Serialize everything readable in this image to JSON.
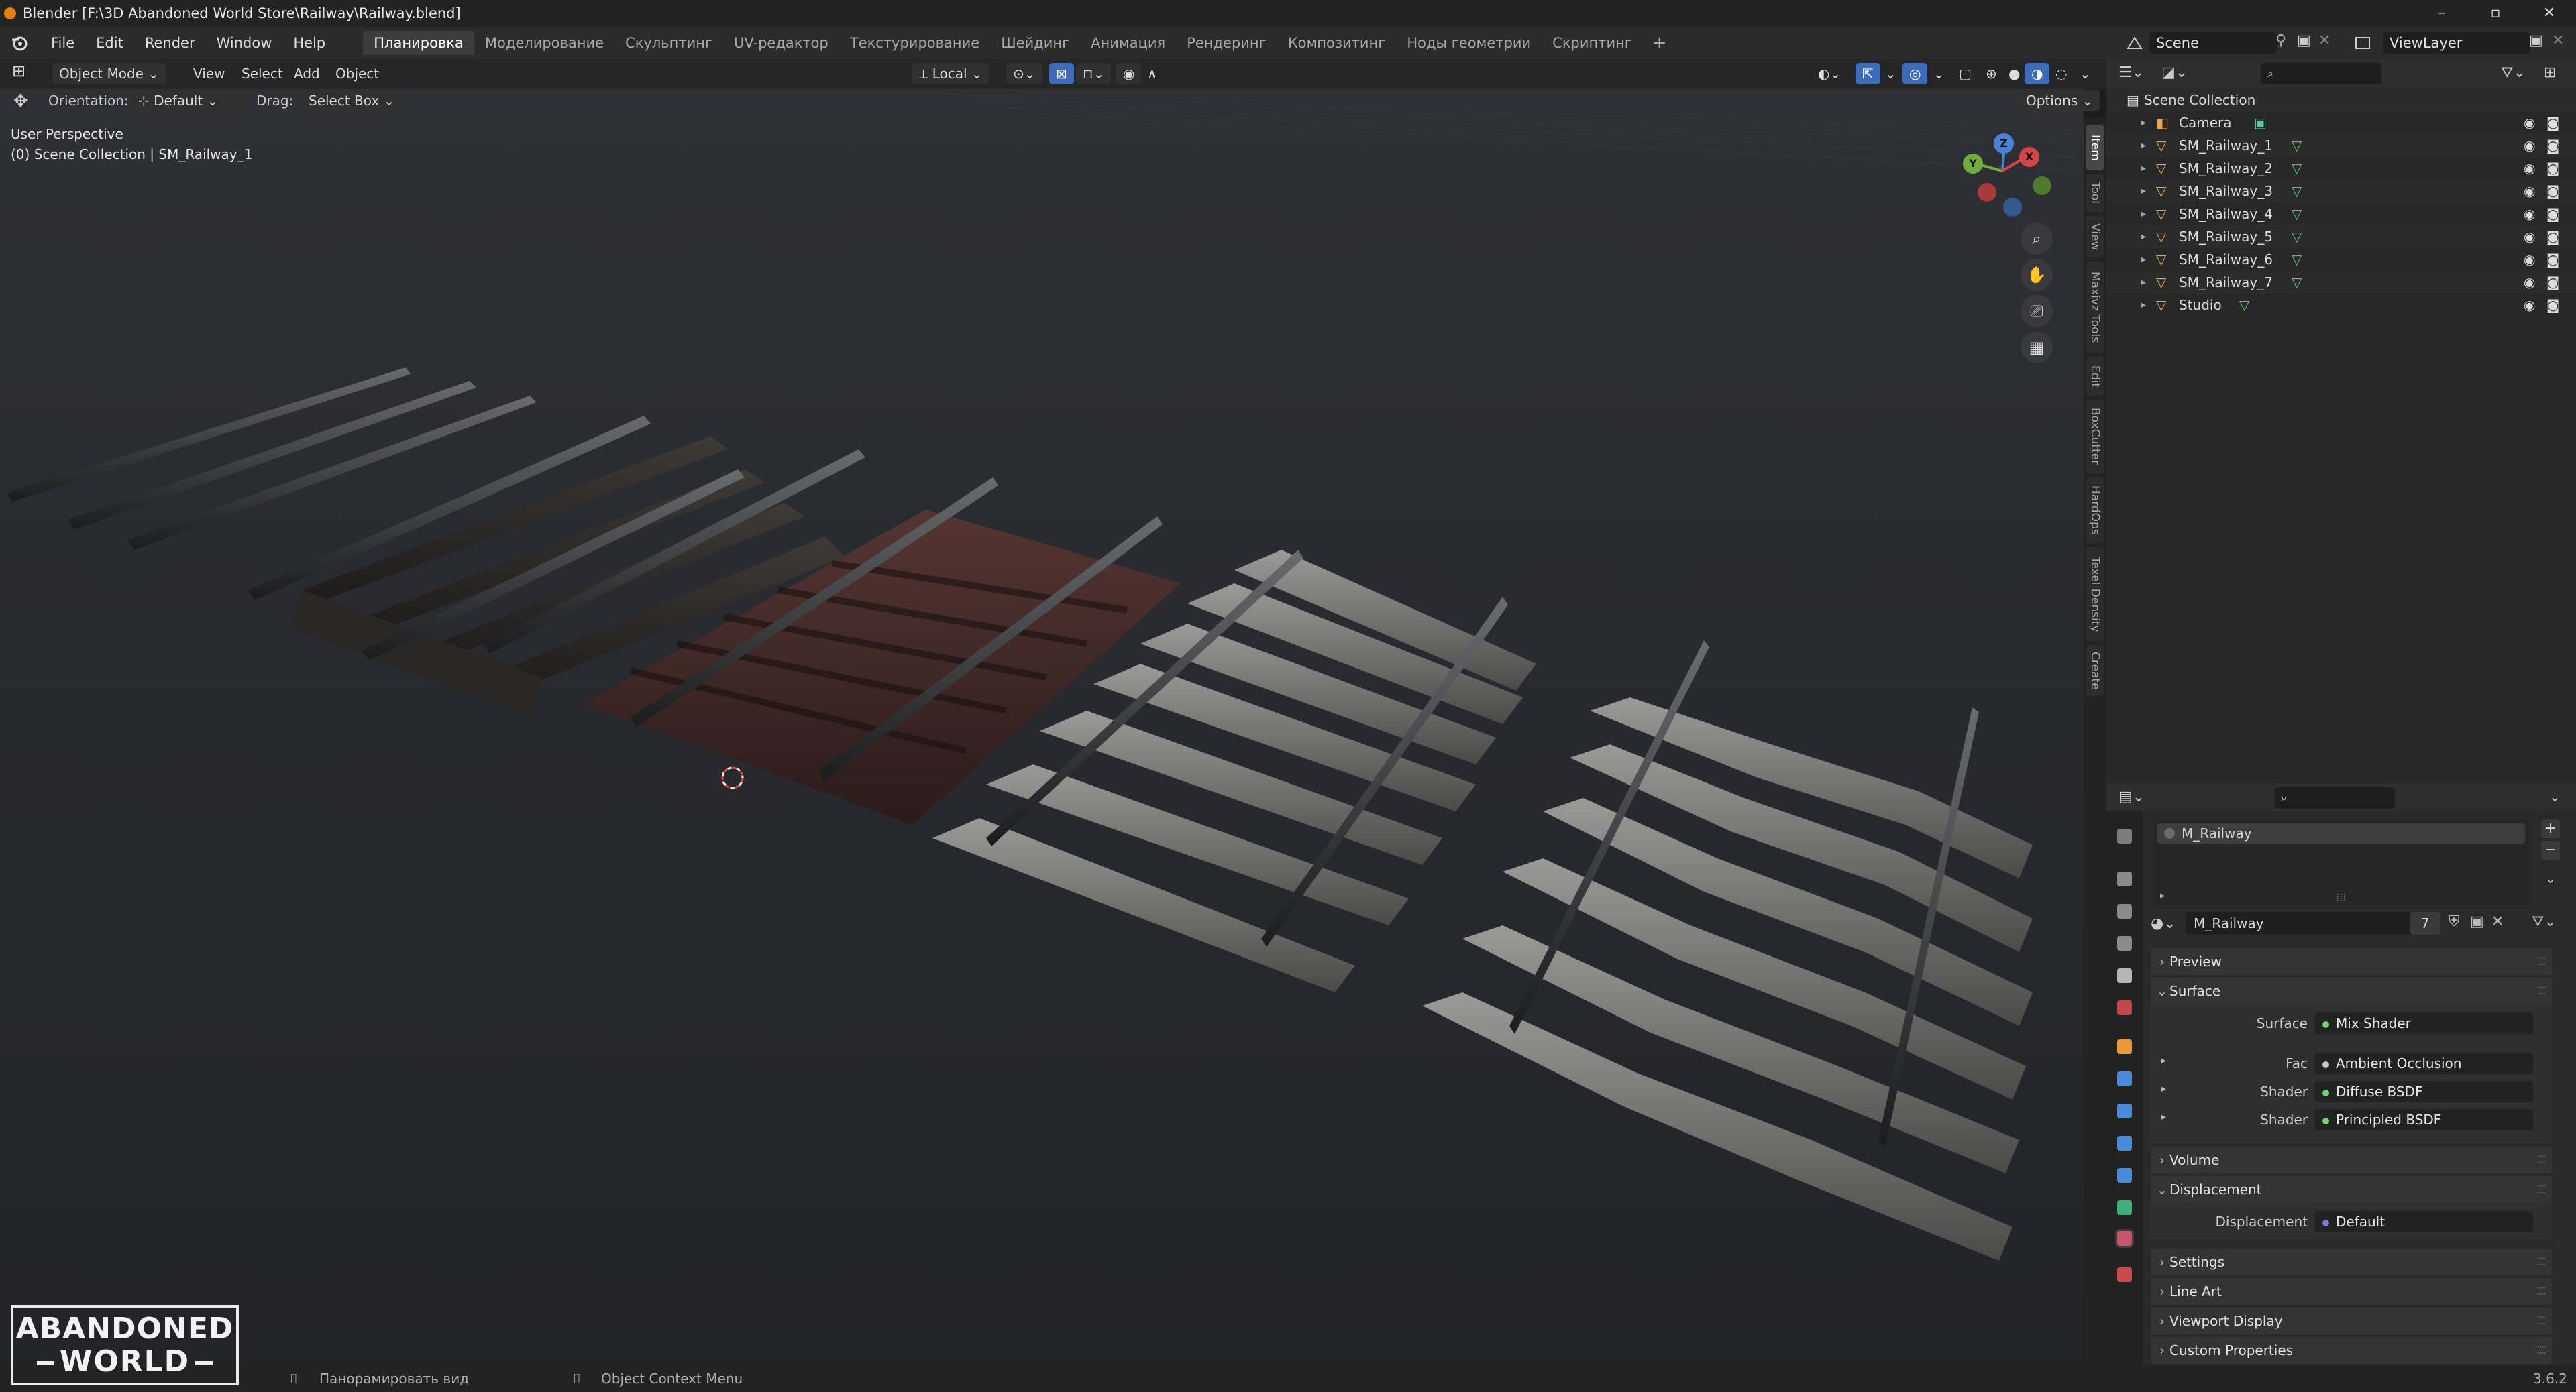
{
  "window": {
    "title": "Blender [F:\\3D Abandoned World Store\\Railway\\Railway.blend]",
    "controls": [
      "–",
      "▫",
      "✕"
    ]
  },
  "menu": {
    "items": [
      "File",
      "Edit",
      "Render",
      "Window",
      "Help"
    ],
    "workspaces": [
      "Планировка",
      "Моделирование",
      "Скульптинг",
      "UV-редактор",
      "Текстурирование",
      "Шейдинг",
      "Анимация",
      "Рендеринг",
      "Композитинг",
      "Ноды геометрии",
      "Скриптинг"
    ],
    "active_workspace": "Планировка",
    "add_workspace": "+"
  },
  "scene": {
    "name": "Scene",
    "view_layer": "ViewLayer"
  },
  "viewport_header": {
    "mode": "Object Mode",
    "menus": [
      "View",
      "Select",
      "Add",
      "Object"
    ],
    "transform": "Local",
    "orientation_label": "Orientation:",
    "orientation_value": "Default",
    "drag_label": "Drag:",
    "drag_value": "Select Box",
    "options": "Options"
  },
  "viewport": {
    "perspective": "User Perspective",
    "collection_info": "(0) Scene Collection | SM_Railway_1",
    "gizmo": {
      "z": "Z",
      "y": "Y",
      "x": "X"
    }
  },
  "sidebar_tabs": [
    "Item",
    "Tool",
    "View",
    "Maxivz Tools",
    "Edit",
    "BoxCutter",
    "HardOps",
    "Texel Density",
    "Create"
  ],
  "outliner": {
    "root": "Scene Collection",
    "items": [
      {
        "name": "Camera",
        "type": "camera"
      },
      {
        "name": "SM_Railway_1",
        "type": "mesh"
      },
      {
        "name": "SM_Railway_2",
        "type": "mesh"
      },
      {
        "name": "SM_Railway_3",
        "type": "mesh"
      },
      {
        "name": "SM_Railway_4",
        "type": "mesh"
      },
      {
        "name": "SM_Railway_5",
        "type": "mesh"
      },
      {
        "name": "SM_Railway_6",
        "type": "mesh"
      },
      {
        "name": "SM_Railway_7",
        "type": "mesh"
      },
      {
        "name": "Studio",
        "type": "mesh"
      }
    ]
  },
  "properties": {
    "slot": "M_Railway",
    "material_name": "M_Railway",
    "users": "7",
    "sections": {
      "preview": "Preview",
      "surface": "Surface",
      "volume": "Volume",
      "displacement": "Displacement",
      "settings": "Settings",
      "line_art": "Line Art",
      "viewport_display": "Viewport Display",
      "custom_properties": "Custom Properties"
    },
    "fields": [
      {
        "label": "Surface",
        "value": "Mix Shader",
        "color": "#6ed26e"
      },
      {
        "label": "Fac",
        "value": "Ambient Occlusion",
        "color": "#c7c7c7"
      },
      {
        "label": "Shader",
        "value": "Diffuse BSDF",
        "color": "#6ed26e"
      },
      {
        "label": "Shader",
        "value": "Principled BSDF",
        "color": "#6ed26e"
      },
      {
        "label": "Displacement",
        "value": "Default",
        "color": "#7a7ad6"
      }
    ]
  },
  "status": {
    "pan": "Панорамировать вид",
    "context_menu": "Object Context Menu",
    "version": "3.6.2"
  },
  "watermark": {
    "line1": "ABANDONED",
    "line2": "WORLD"
  }
}
